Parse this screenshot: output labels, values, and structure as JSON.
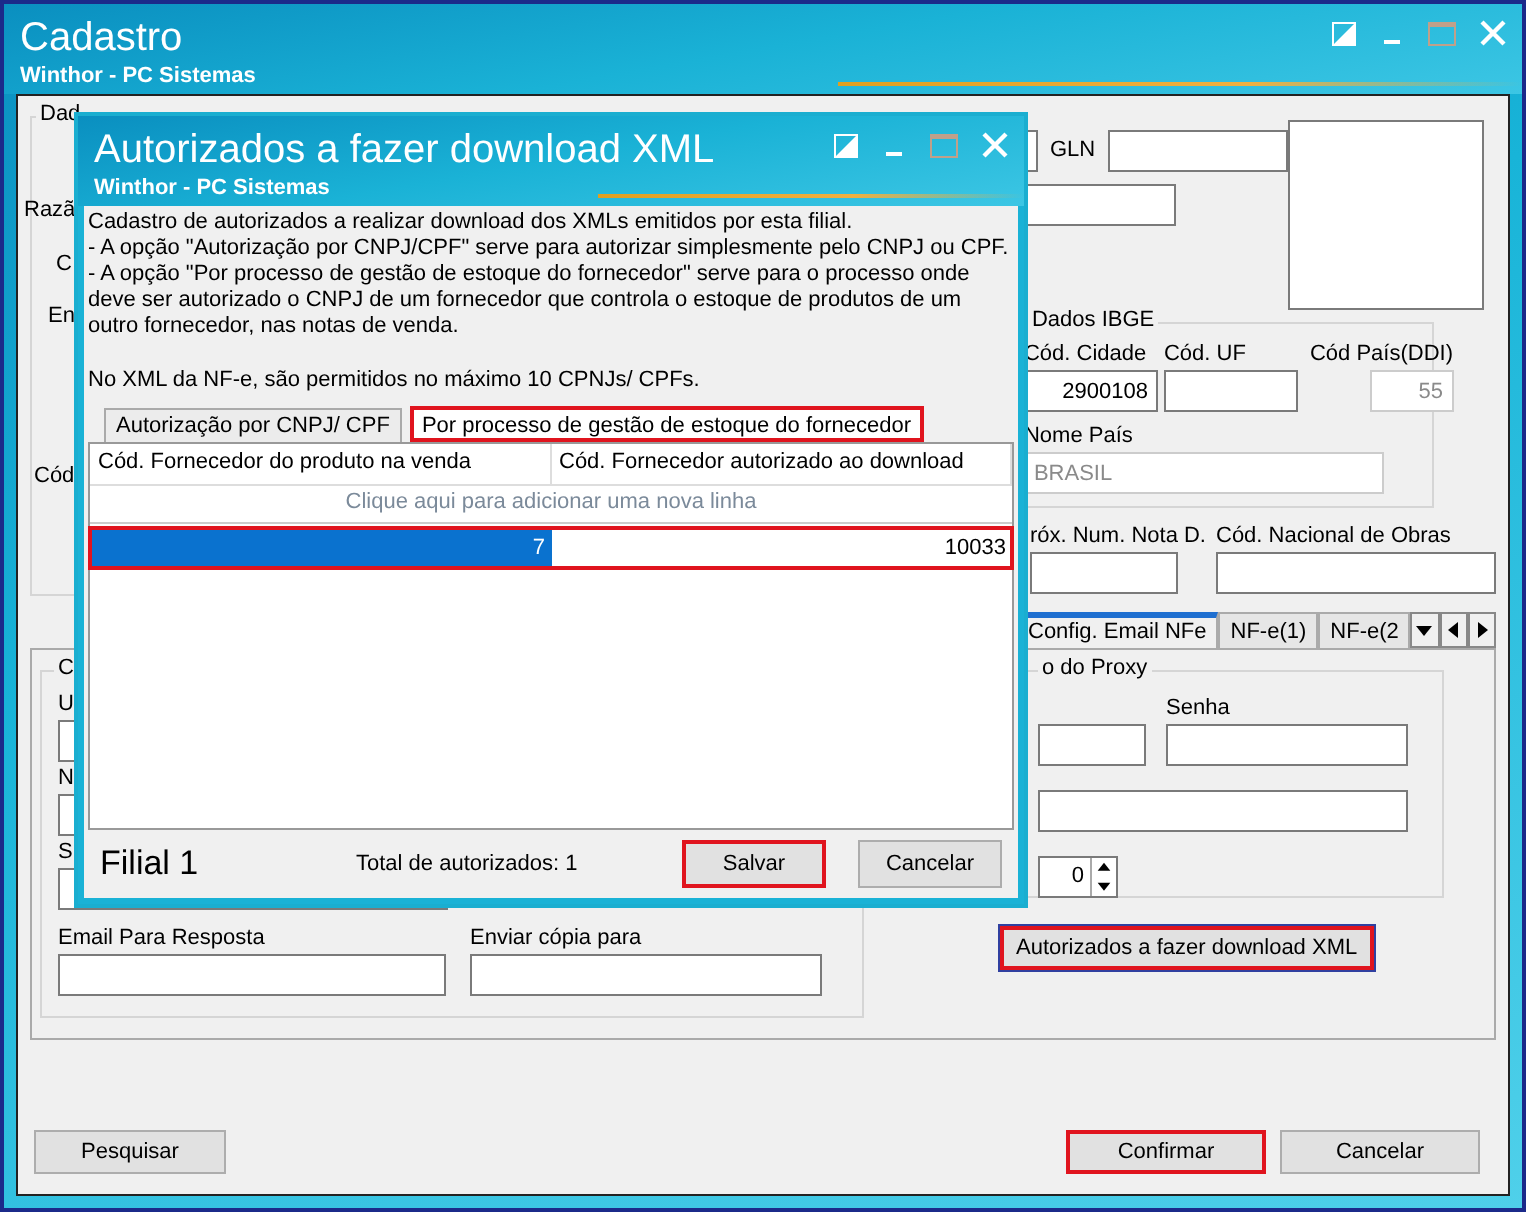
{
  "window": {
    "title": "Cadastro",
    "subtitle": "Winthor - PC Sistemas"
  },
  "main_group": {
    "caption": "Dad",
    "labels": [
      "Razã",
      "C",
      "En",
      "Cód"
    ]
  },
  "gln": {
    "label": "GLN"
  },
  "ibge": {
    "title": "Dados IBGE",
    "fields": [
      {
        "label": "Cód. Cidade",
        "value": "2900108",
        "disabled": false
      },
      {
        "label": "Cód. UF",
        "disabled": false
      },
      {
        "label": "Cód País(DDI)",
        "value": "55",
        "disabled": true
      }
    ],
    "country": {
      "label": "Nome País",
      "value": "BRASIL",
      "disabled": true
    }
  },
  "numbering": {
    "labels": [
      "róx. Num. Nota D.",
      "Cód. Nacional de Obras"
    ]
  },
  "tabs": [
    {
      "label": "Config. Email NFe",
      "selected": true
    },
    {
      "label": "NF-e(1)",
      "selected": false
    },
    {
      "label": "NF-e(2",
      "selected": false
    }
  ],
  "email_group": {
    "caption": "C",
    "labels": [
      "U",
      "N",
      "S"
    ],
    "reply_label": "Email Para Resposta",
    "copy_label": "Enviar cópia para"
  },
  "proxy_group": {
    "caption": "o do Proxy",
    "password_label": "Senha",
    "port_value": "0"
  },
  "xml_button": {
    "label": "Autorizados a fazer download XML",
    "highlighted": true
  },
  "buttons": [
    {
      "label": "Pesquisar",
      "highlighted": false
    },
    {
      "label": "Confirmar",
      "highlighted": true
    },
    {
      "label": "Cancelar",
      "highlighted": false
    }
  ],
  "dialog": {
    "title": "Autorizados a fazer download XML",
    "subtitle": "Winthor - PC Sistemas",
    "description": [
      "Cadastro de autorizados a realizar download dos XMLs emitidos por esta filial.",
      "- A opção \"Autorização por CNPJ/CPF\" serve para autorizar simplesmente pelo CNPJ ou CPF.",
      "- A opção \"Por processo de gestão de estoque do fornecedor\" serve para o processo onde deve ser autorizado o CNPJ de um fornecedor que controla o estoque de produtos de um outro fornecedor, nas notas de venda."
    ],
    "note": "No XML da NF-e, são permitidos no máximo 10 CPNJs/ CPFs.",
    "tabs": [
      {
        "label": "Autorização por CNPJ/ CPF",
        "selected": false,
        "highlighted": false
      },
      {
        "label": "Por processo de gestão de estoque do fornecedor",
        "selected": true,
        "highlighted": true
      }
    ],
    "columns": [
      "Cód. Fornecedor do produto na venda",
      "Cód. Fornecedor autorizado ao download"
    ],
    "add_row_hint": "Clique aqui para adicionar uma nova linha",
    "rows": [
      {
        "highlighted": true,
        "cells": [
          {
            "text": "7",
            "selected": true
          },
          {
            "text": "10033",
            "selected": false
          }
        ]
      }
    ],
    "branch": "Filial 1",
    "total": "Total de autorizados: 1",
    "buttons": [
      {
        "label": "Salvar",
        "highlighted": true
      },
      {
        "label": "Cancelar",
        "highlighted": false
      }
    ]
  }
}
